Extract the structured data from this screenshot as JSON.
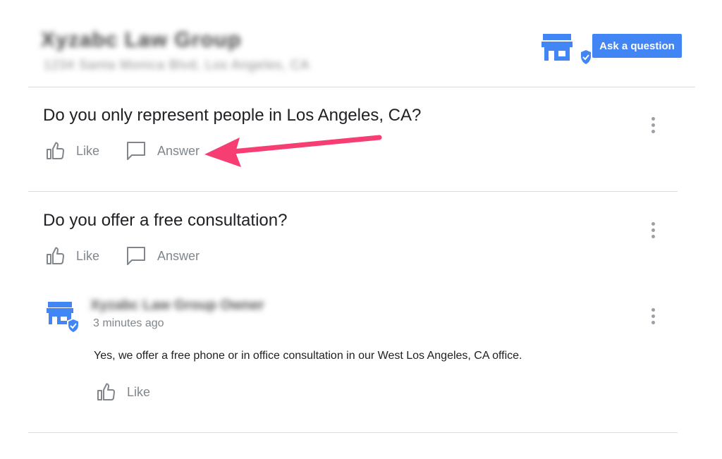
{
  "header": {
    "business_name": "Xyzabc Law Group",
    "business_address": "1234 Santa Monica Blvd, Los Angeles, CA",
    "ask_button": "Ask a question",
    "store_icon": "storefront-verified-icon"
  },
  "questions": [
    {
      "text": "Do you only represent people in Los Angeles, CA?",
      "like_label": "Like",
      "answer_label": "Answer"
    },
    {
      "text": "Do you offer a free consultation?",
      "like_label": "Like",
      "answer_label": "Answer",
      "answer": {
        "author": "Xyzabc Law Group Owner",
        "time": "3 minutes ago",
        "text": "Yes, we offer a free phone or in office consultation in our West Los Angeles, CA office.",
        "like_label": "Like"
      }
    }
  ],
  "colors": {
    "accent": "#4285f4",
    "arrow": "#f73e73",
    "divider": "#dadce0",
    "muted": "#80868b"
  }
}
